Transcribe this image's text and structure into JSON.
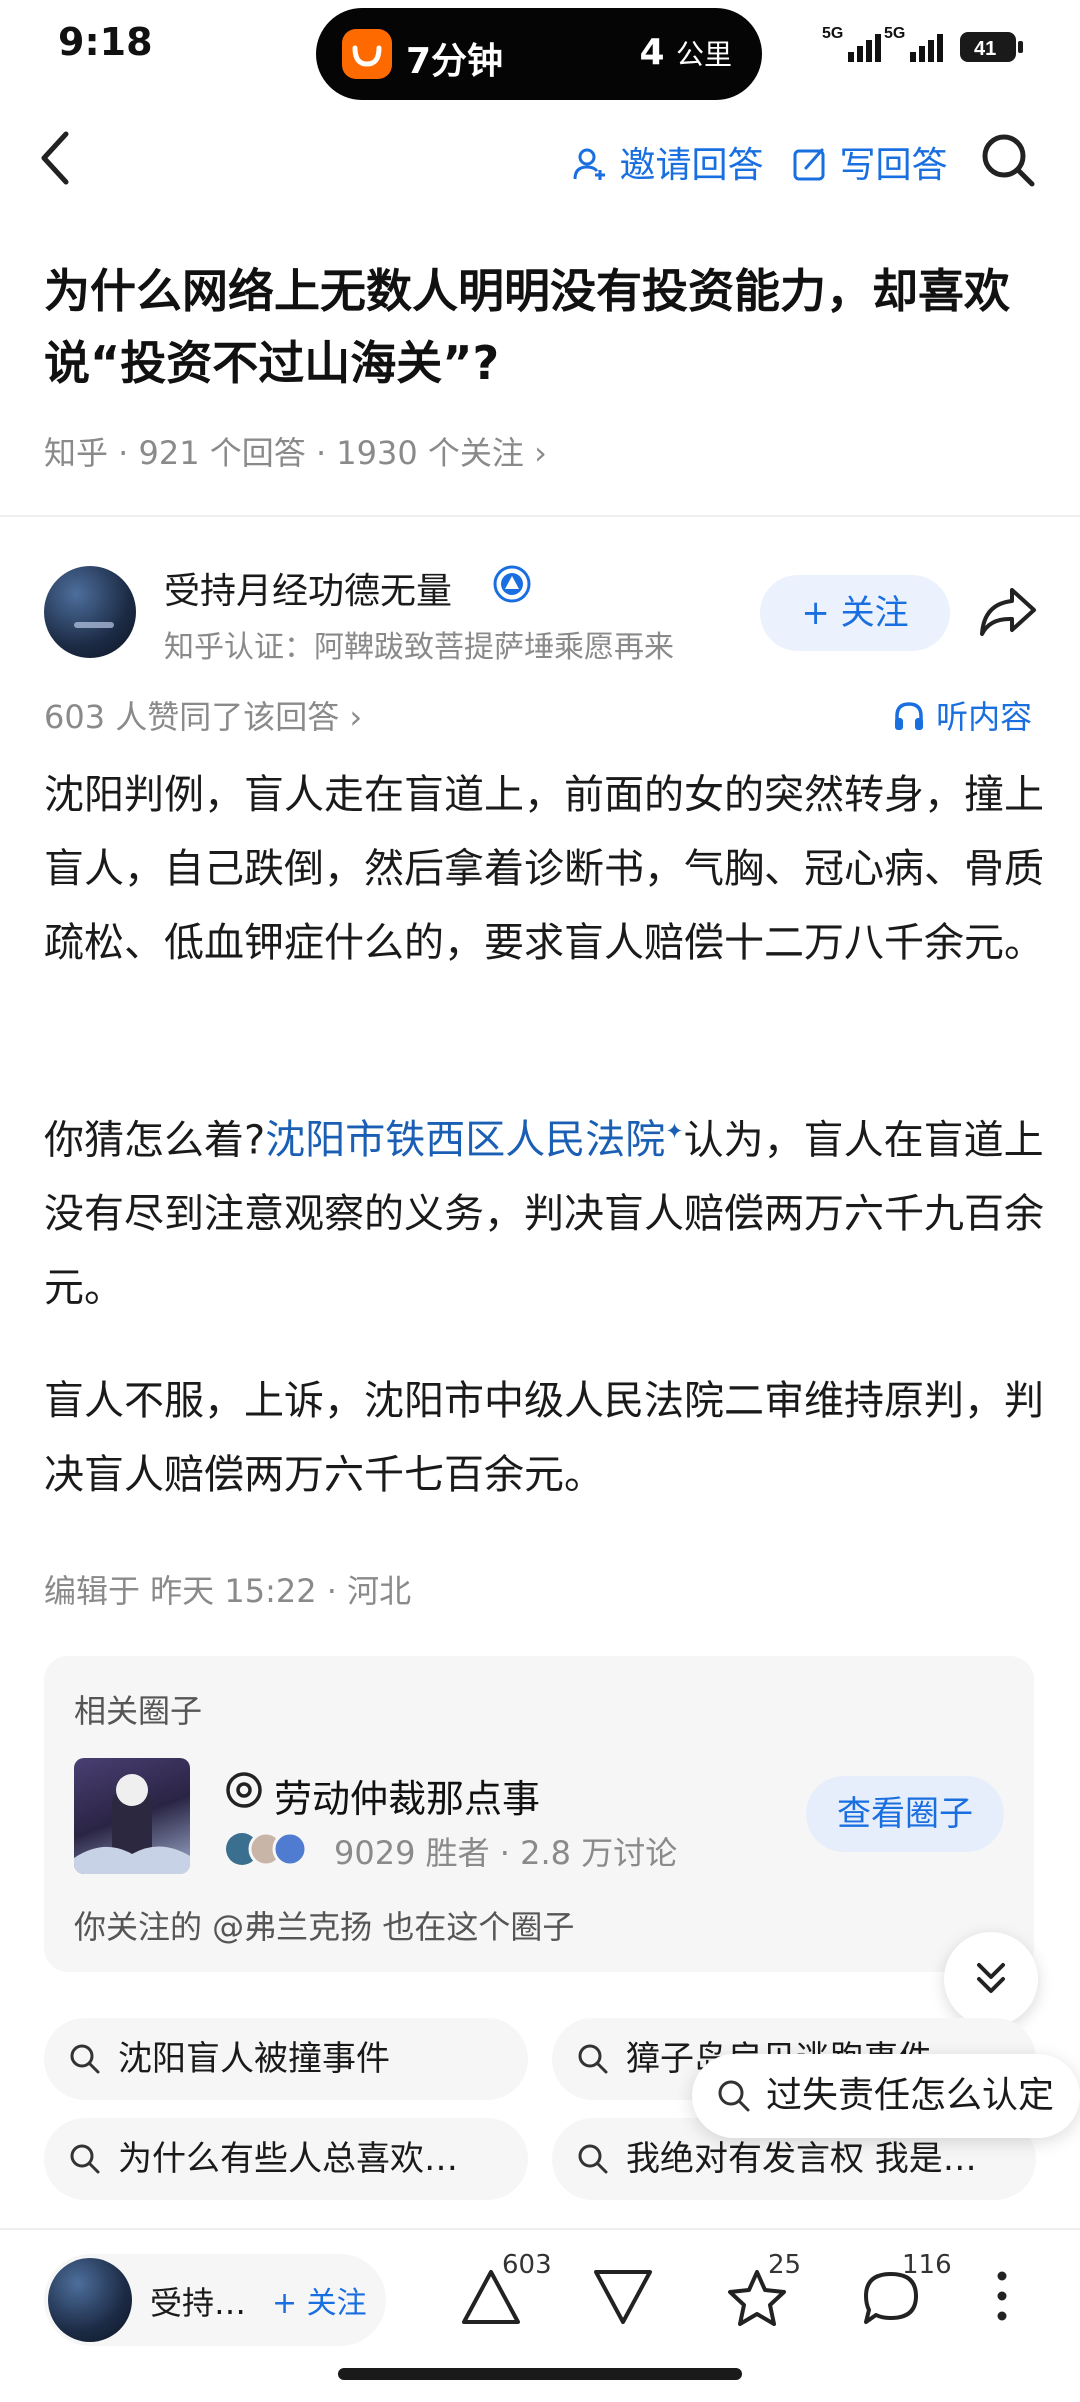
{
  "status_bar": {
    "time": "9:18",
    "island": {
      "left": "7分钟",
      "right_value": "4",
      "right_unit": "公里"
    },
    "signal_1": "5G",
    "signal_2": "5G",
    "battery": "41"
  },
  "nav": {
    "invite_label": "邀请回答",
    "write_label": "写回答"
  },
  "question": {
    "title": "为什么网络上无数人明明没有投资能力，却喜欢说“投资不过山海关”?",
    "meta": "知乎 · 921 个回答 · 1930 个关注 ›"
  },
  "answer": {
    "author_name": "受持月经功德无量",
    "author_sub": "知乎认证：阿鞞跋致菩提萨埵乘愿再来",
    "follow_label": "+ 关注",
    "likes_line": "603 人赞同了该回答 ›",
    "listen_label": "听内容",
    "paragraph_1": "沈阳判例，盲人走在盲道上，前面的女的突然转身，撞上盲人，自己跌倒，然后拿着诊断书，气胸、冠心病、骨质疏松、低血钾症什么的，要求盲人赔偿十二万八千余元。",
    "paragraph_2_prefix": "你猜怎么着?",
    "paragraph_2_link": "沈阳市铁西区人民法院",
    "paragraph_2_link_mark": "✦",
    "paragraph_2_suffix": "认为，盲人在盲道上没有尽到注意观察的义务，判决盲人赔偿两万六千九百余元。",
    "paragraph_3": "盲人不服，上诉，沈阳市中级人民法院二审维持原判，判决盲人赔偿两万六千七百余元。",
    "edit_line": "编辑于 昨天 15:22 · 河北"
  },
  "circle": {
    "heading": "相关圈子",
    "name": "劳动仲裁那点事",
    "stats": "9029 胜者 · 2.8 万讨论",
    "button": "查看圈子",
    "note": "你关注的 @弗兰克扬 也在这个圈子"
  },
  "related": {
    "chips": [
      "沈阳盲人被撞事件",
      "獐子岛扇贝逃跑事件",
      "为什么有些人总喜欢…",
      "我绝对有发言权 我是…"
    ],
    "floating_chip": "过失责任怎么认定"
  },
  "bottom_bar": {
    "author_short": "受持…",
    "follow_label": "+ 关注",
    "upvote_count": "603",
    "favorite_count": "25",
    "comment_count": "116"
  },
  "colors": {
    "accent": "#1a6fe0",
    "link": "#1a5fb4",
    "muted": "#8a8a8a",
    "chip_bg": "#f6f6f7"
  },
  "icons": [
    "back-arrow-icon",
    "invite-person-icon",
    "edit-pen-icon",
    "search-icon",
    "verified-badge-icon",
    "share-arrow-icon",
    "headphone-icon",
    "circle-ring-icon",
    "chevron-double-down-icon",
    "upvote-icon",
    "downvote-icon",
    "star-icon",
    "comment-icon",
    "more-vertical-icon"
  ]
}
